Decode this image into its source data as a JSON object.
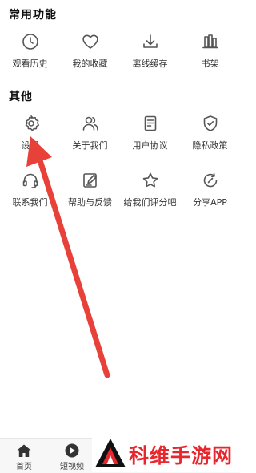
{
  "sections": {
    "common": {
      "title": "常用功能",
      "items": [
        {
          "label": "观看历史",
          "icon": "clock-icon"
        },
        {
          "label": "我的收藏",
          "icon": "heart-icon"
        },
        {
          "label": "离线缓存",
          "icon": "download-icon"
        },
        {
          "label": "书架",
          "icon": "bookshelf-icon"
        }
      ]
    },
    "other": {
      "title": "其他",
      "items": [
        {
          "label": "设置",
          "icon": "gear-icon"
        },
        {
          "label": "关于我们",
          "icon": "users-icon"
        },
        {
          "label": "用户协议",
          "icon": "document-icon"
        },
        {
          "label": "隐私政策",
          "icon": "shield-check-icon"
        },
        {
          "label": "联系我们",
          "icon": "headset-icon"
        },
        {
          "label": "帮助与反馈",
          "icon": "edit-icon"
        },
        {
          "label": "给我们评分吧",
          "icon": "star-icon"
        },
        {
          "label": "分享APP",
          "icon": "share-icon"
        }
      ]
    }
  },
  "tabbar": {
    "items": [
      {
        "label": "首页",
        "icon": "home-icon"
      },
      {
        "label": "短视频",
        "icon": "play-icon"
      }
    ]
  },
  "watermark": {
    "text": "科维手游网"
  },
  "colors": {
    "arrow": "#e8413a",
    "icon_stroke": "#555555",
    "watermark": "#e8262d"
  }
}
